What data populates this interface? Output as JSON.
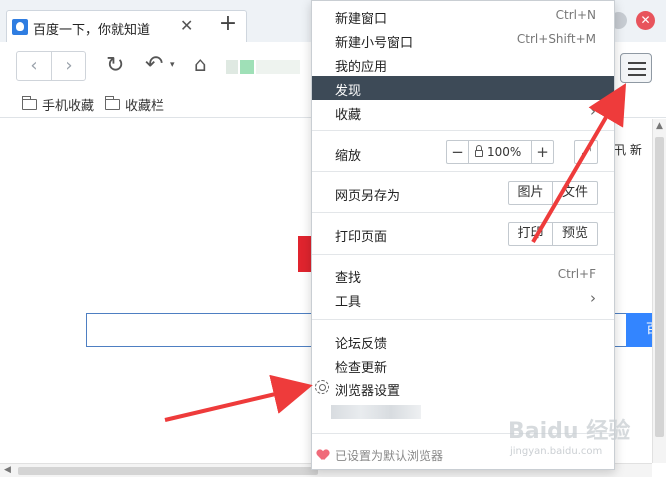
{
  "tab": {
    "title": "百度一下，你就知道",
    "close": "✕",
    "new_tab": "+"
  },
  "window": {
    "close_glyph": "✕"
  },
  "toolbar": {
    "back": "‹",
    "forward": "›",
    "reload": "↻",
    "undo": "↶",
    "undo_caret": "▾",
    "home": "⌂"
  },
  "bookmarks": [
    {
      "label": "手机收藏"
    },
    {
      "label": "收藏栏"
    }
  ],
  "page": {
    "search_button": "百",
    "topnav": "卂 新"
  },
  "scroll": {
    "up": "▲",
    "left": "◀"
  },
  "menu": {
    "new_window": {
      "label": "新建窗口",
      "shortcut": "Ctrl+N"
    },
    "new_private": {
      "label": "新建小号窗口",
      "shortcut": "Ctrl+Shift+M"
    },
    "my_apps": {
      "label": "我的应用"
    },
    "discover": {
      "label": "发现"
    },
    "favorites": {
      "label": "收藏",
      "arrow": "›"
    },
    "zoom": {
      "label": "缩放",
      "minus": "−",
      "value": "100%",
      "plus": "+",
      "fullscreen": "⤢"
    },
    "save_page": {
      "label": "网页另存为",
      "image": "图片",
      "file": "文件"
    },
    "print": {
      "label": "打印页面",
      "print": "打印",
      "preview": "预览"
    },
    "find": {
      "label": "查找",
      "shortcut": "Ctrl+F"
    },
    "tools": {
      "label": "工具",
      "arrow": "›"
    },
    "feedback": {
      "label": "论坛反馈"
    },
    "check_update": {
      "label": "检查更新"
    },
    "settings": {
      "label": "浏览器设置"
    },
    "default_browser": {
      "label": "已设置为默认浏览器"
    }
  },
  "watermark": {
    "brand": "Baidu 经验",
    "url": "jingyan.baidu.com"
  },
  "colors": {
    "highlight": "#3d4a57",
    "arrow": "#ee3b3b",
    "search_blue": "#3385ff",
    "logo_red": "#e0242e"
  }
}
